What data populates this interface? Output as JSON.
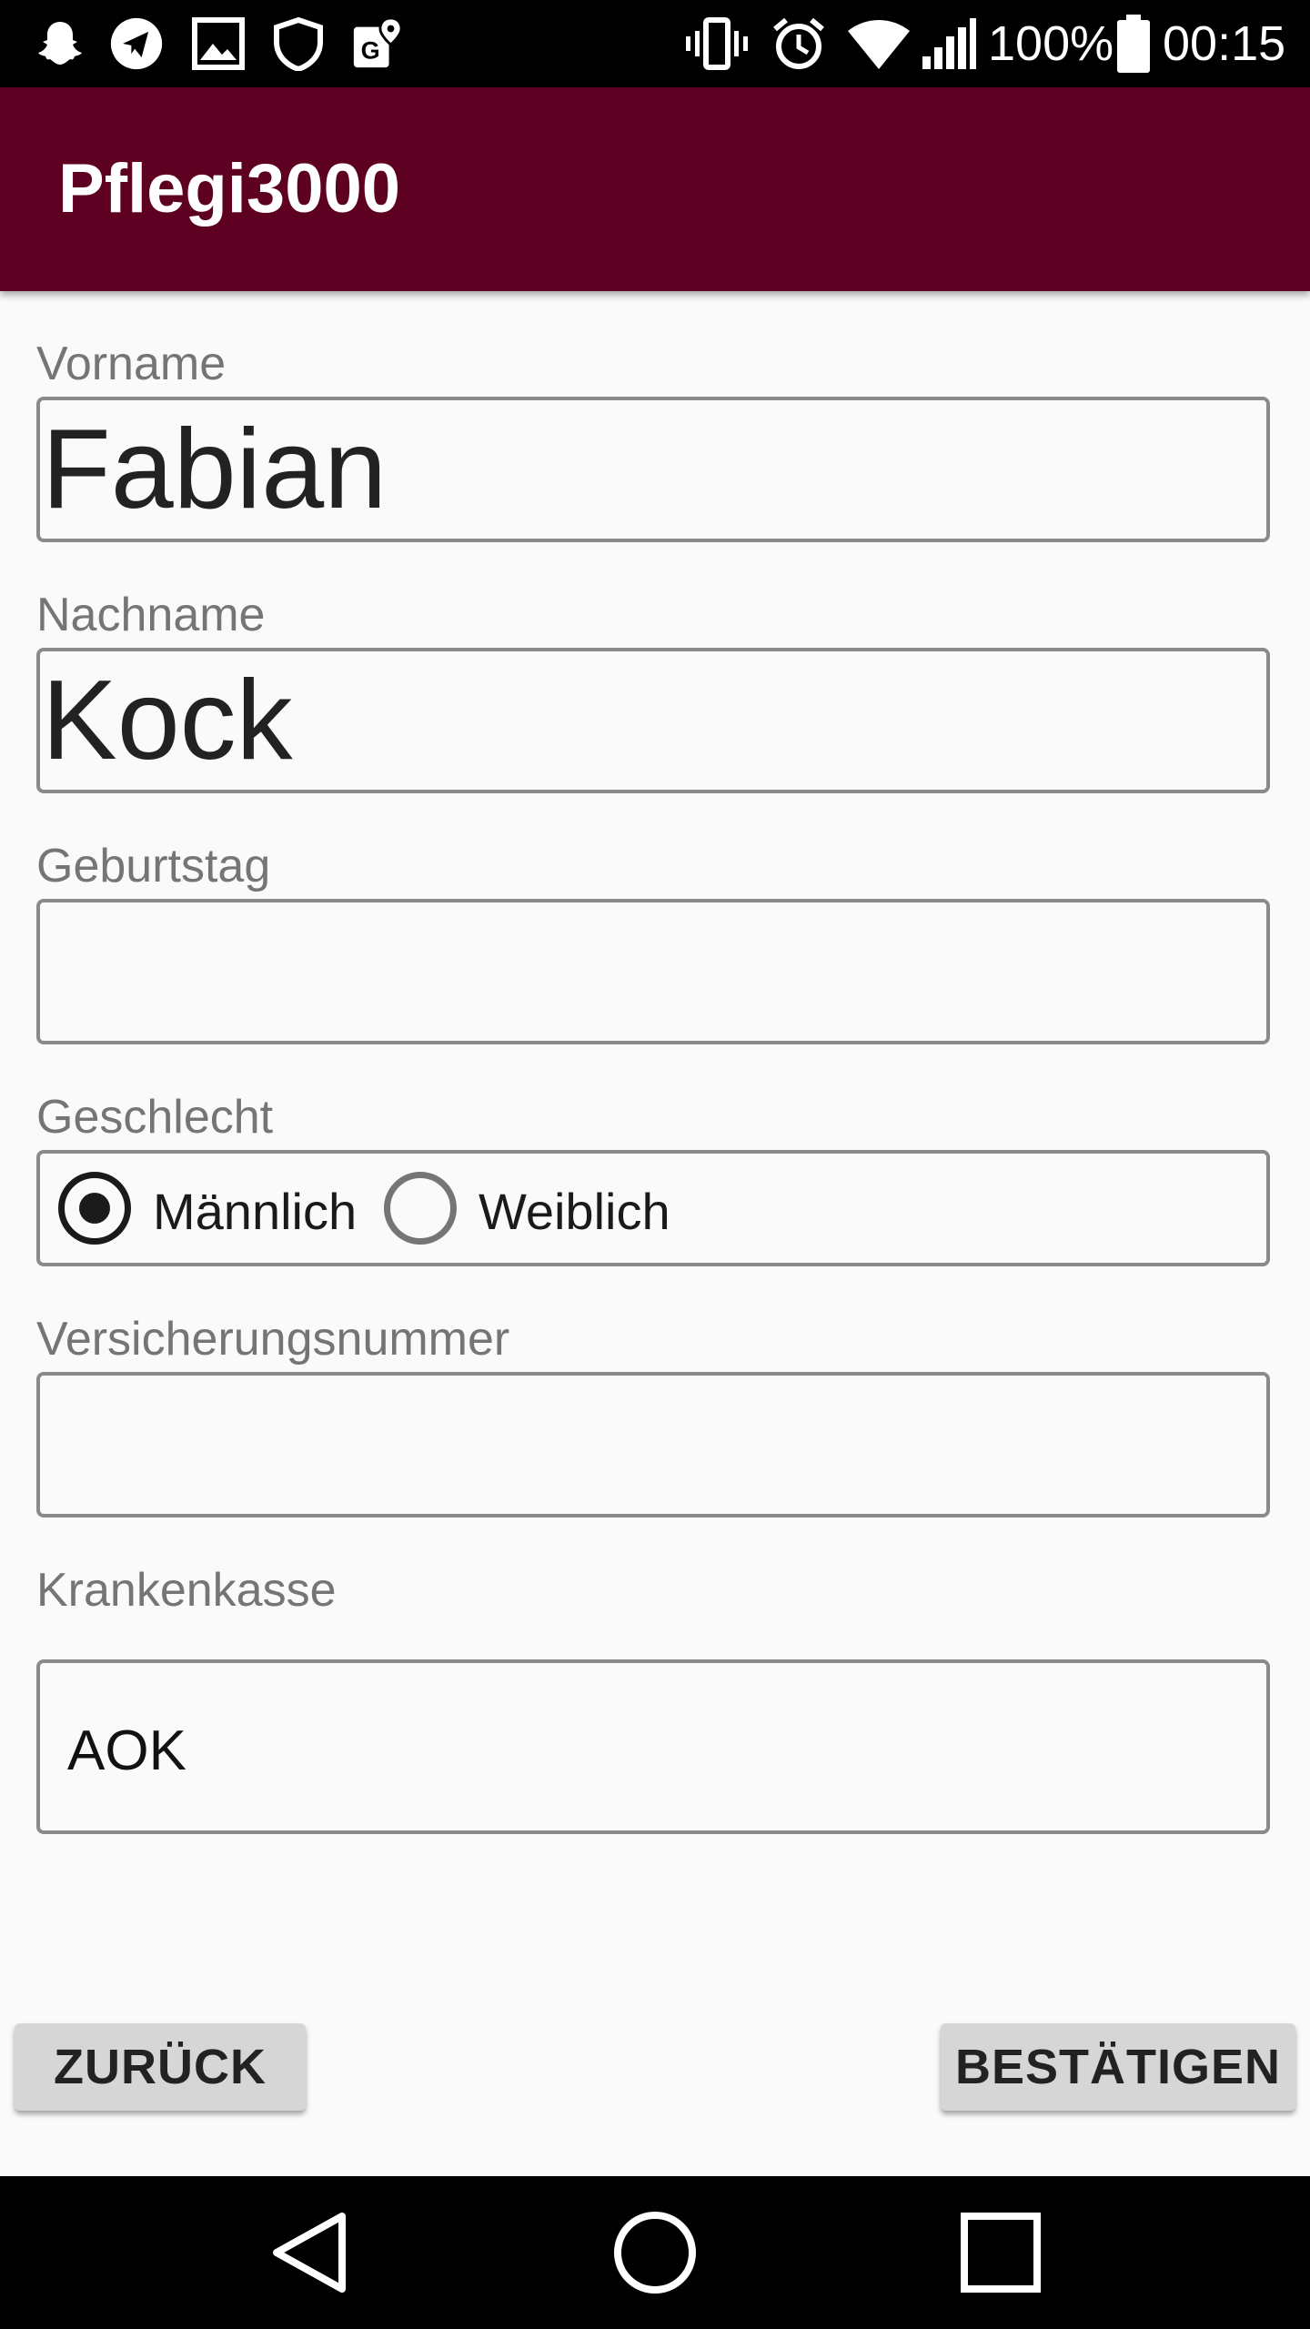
{
  "status_bar": {
    "battery": "100%",
    "time": "00:15",
    "icons": [
      "snapchat-icon",
      "telegram-icon",
      "gallery-icon",
      "shield-icon",
      "maps-icon",
      "vibrate-icon",
      "alarm-icon",
      "wifi-icon",
      "signal-icon",
      "battery-icon"
    ]
  },
  "app_bar": {
    "title": "Pflegi3000",
    "color": "#5e0021"
  },
  "form": {
    "vorname": {
      "label": "Vorname",
      "value": "Fabian"
    },
    "nachname": {
      "label": "Nachname",
      "value": "Kock"
    },
    "geburtstag": {
      "label": "Geburtstag",
      "value": ""
    },
    "geschlecht": {
      "label": "Geschlecht",
      "options": [
        "Männlich",
        "Weiblich"
      ],
      "selected": "Männlich"
    },
    "versicherungsnummer": {
      "label": "Versicherungsnummer",
      "value": ""
    },
    "krankenkasse": {
      "label": "Krankenkasse",
      "value": "AOK"
    }
  },
  "buttons": {
    "back_label": "ZURÜCK",
    "confirm_label": "BESTÄTIGEN"
  },
  "nav_bar": {
    "icons": [
      "back-triangle-icon",
      "home-circle-icon",
      "recents-square-icon"
    ]
  }
}
